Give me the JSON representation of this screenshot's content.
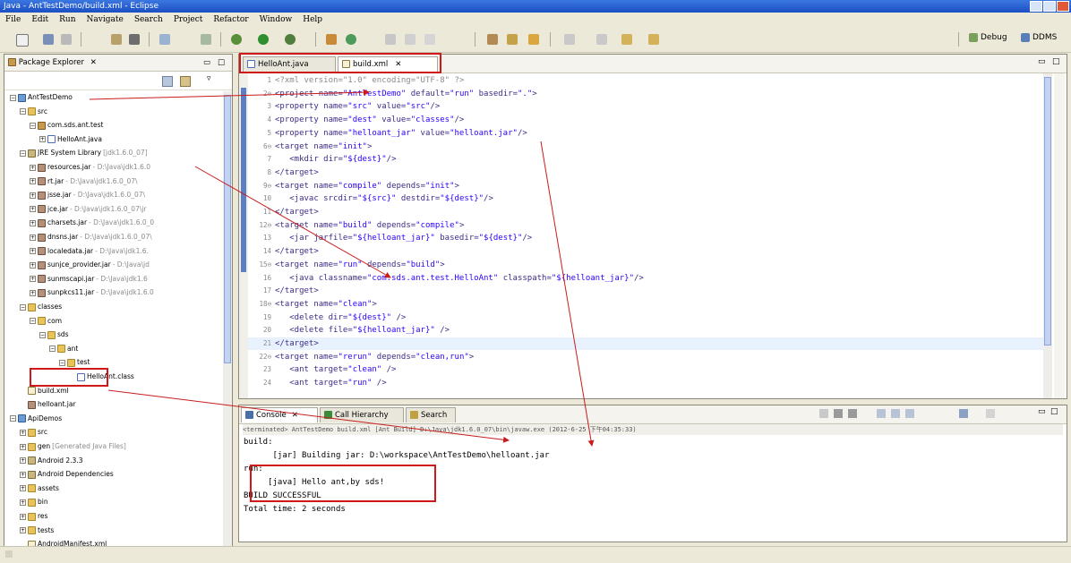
{
  "window": {
    "title": "Java - AntTestDemo/build.xml - Eclipse"
  },
  "menu": [
    "File",
    "Edit",
    "Run",
    "Navigate",
    "Search",
    "Project",
    "Refactor",
    "Window",
    "Help"
  ],
  "perspectives": {
    "debug": "Debug",
    "ddms": "DDMS"
  },
  "package_explorer": {
    "title": "Package Explorer",
    "rows": [
      {
        "label": "AntTestDemo",
        "note": "",
        "depth": 0,
        "icon": "proj",
        "tw": "-"
      },
      {
        "label": "src",
        "note": "",
        "depth": 1,
        "icon": "folder",
        "tw": "-"
      },
      {
        "label": "com.sds.ant.test",
        "note": "",
        "depth": 2,
        "icon": "pkg",
        "tw": "-"
      },
      {
        "label": "HelloAnt.java",
        "note": "",
        "depth": 3,
        "icon": "javafile",
        "tw": "+"
      },
      {
        "label": "JRE System Library",
        "note": "[jdk1.6.0_07]",
        "depth": 1,
        "icon": "lib",
        "tw": "-"
      },
      {
        "label": "resources.jar",
        "note": "- D:\\Java\\jdk1.6.0",
        "depth": 2,
        "icon": "jar",
        "tw": "+"
      },
      {
        "label": "rt.jar",
        "note": "- D:\\Java\\jdk1.6.0_07\\",
        "depth": 2,
        "icon": "jar",
        "tw": "+"
      },
      {
        "label": "jsse.jar",
        "note": "- D:\\Java\\jdk1.6.0_07\\",
        "depth": 2,
        "icon": "jar",
        "tw": "+"
      },
      {
        "label": "jce.jar",
        "note": "- D:\\Java\\jdk1.6.0_07\\jr",
        "depth": 2,
        "icon": "jar",
        "tw": "+"
      },
      {
        "label": "charsets.jar",
        "note": "- D:\\Java\\jdk1.6.0_0",
        "depth": 2,
        "icon": "jar",
        "tw": "+"
      },
      {
        "label": "dnsns.jar",
        "note": "- D:\\Java\\jdk1.6.0_07\\",
        "depth": 2,
        "icon": "jar",
        "tw": "+"
      },
      {
        "label": "localedata.jar",
        "note": "- D:\\Java\\jdk1.6.",
        "depth": 2,
        "icon": "jar",
        "tw": "+"
      },
      {
        "label": "sunjce_provider.jar",
        "note": "- D:\\Java\\jd",
        "depth": 2,
        "icon": "jar",
        "tw": "+"
      },
      {
        "label": "sunmscapi.jar",
        "note": "- D:\\Java\\jdk1.6",
        "depth": 2,
        "icon": "jar",
        "tw": "+"
      },
      {
        "label": "sunpkcs11.jar",
        "note": "- D:\\Java\\jdk1.6.0",
        "depth": 2,
        "icon": "jar",
        "tw": "+"
      },
      {
        "label": "classes",
        "note": "",
        "depth": 1,
        "icon": "folder",
        "tw": "-"
      },
      {
        "label": "com",
        "note": "",
        "depth": 2,
        "icon": "folder",
        "tw": "-"
      },
      {
        "label": "sds",
        "note": "",
        "depth": 3,
        "icon": "folder",
        "tw": "-"
      },
      {
        "label": "ant",
        "note": "",
        "depth": 4,
        "icon": "folder",
        "tw": "-"
      },
      {
        "label": "test",
        "note": "",
        "depth": 5,
        "icon": "folder",
        "tw": "-"
      },
      {
        "label": "HelloAnt.class",
        "note": "",
        "depth": 6,
        "icon": "javafile",
        "tw": ""
      },
      {
        "label": "build.xml",
        "note": "",
        "depth": 1,
        "icon": "xmlfile",
        "tw": ""
      },
      {
        "label": "helloant.jar",
        "note": "",
        "depth": 1,
        "icon": "jar",
        "tw": ""
      },
      {
        "label": "ApiDemos",
        "note": "",
        "depth": 0,
        "icon": "proj",
        "tw": "-"
      },
      {
        "label": "src",
        "note": "",
        "depth": 1,
        "icon": "folder",
        "tw": "+"
      },
      {
        "label": "gen",
        "note": "[Generated Java Files]",
        "depth": 1,
        "icon": "folder",
        "tw": "+"
      },
      {
        "label": "Android 2.3.3",
        "note": "",
        "depth": 1,
        "icon": "lib",
        "tw": "+"
      },
      {
        "label": "Android Dependencies",
        "note": "",
        "depth": 1,
        "icon": "lib",
        "tw": "+"
      },
      {
        "label": "assets",
        "note": "",
        "depth": 1,
        "icon": "folder",
        "tw": "+"
      },
      {
        "label": "bin",
        "note": "",
        "depth": 1,
        "icon": "folder",
        "tw": "+"
      },
      {
        "label": "res",
        "note": "",
        "depth": 1,
        "icon": "folder",
        "tw": "+"
      },
      {
        "label": "tests",
        "note": "",
        "depth": 1,
        "icon": "folder",
        "tw": "+"
      },
      {
        "label": "AndroidManifest.xml",
        "note": "",
        "depth": 1,
        "icon": "xmlfile",
        "tw": ""
      }
    ]
  },
  "editor": {
    "tabs": [
      {
        "label": "HelloAnt.java",
        "icon": "javafile",
        "active": false
      },
      {
        "label": "build.xml",
        "icon": "xmlfile",
        "active": true
      }
    ],
    "lines": [
      {
        "n": "1",
        "text": "<?xml version=\"1.0\" encoding=\"UTF-8\" ?>",
        "kind": "pi"
      },
      {
        "n": "2⊖",
        "text": "<project name=\"AntTestDemo\" default=\"run\" basedir=\".\">",
        "kind": "tag"
      },
      {
        "n": "3",
        "text": "<property name=\"src\" value=\"src\"/>",
        "kind": "tag"
      },
      {
        "n": "4",
        "text": "<property name=\"dest\" value=\"classes\"/>",
        "kind": "tag"
      },
      {
        "n": "5",
        "text": "<property name=\"helloant_jar\" value=\"helloant.jar\"/>",
        "kind": "tag"
      },
      {
        "n": "6⊖",
        "text": "<target name=\"init\">",
        "kind": "tag"
      },
      {
        "n": "7",
        "text": "   <mkdir dir=\"${dest}\"/>",
        "kind": "tag"
      },
      {
        "n": "8",
        "text": "</target>",
        "kind": "tag"
      },
      {
        "n": "9⊖",
        "text": "<target name=\"compile\" depends=\"init\">",
        "kind": "tag"
      },
      {
        "n": "10",
        "text": "   <javac srcdir=\"${src}\" destdir=\"${dest}\"/>",
        "kind": "tag"
      },
      {
        "n": "11",
        "text": "</target>",
        "kind": "tag"
      },
      {
        "n": "12⊖",
        "text": "<target name=\"build\" depends=\"compile\">",
        "kind": "tag"
      },
      {
        "n": "13",
        "text": "   <jar jarfile=\"${helloant_jar}\" basedir=\"${dest}\"/>",
        "kind": "tag"
      },
      {
        "n": "14",
        "text": "</target>",
        "kind": "tag"
      },
      {
        "n": "15⊖",
        "text": "<target name=\"run\" depends=\"build\">",
        "kind": "tag"
      },
      {
        "n": "16",
        "text": "   <java classname=\"com.sds.ant.test.HelloAnt\" classpath=\"${helloant_jar}\"/>",
        "kind": "tag"
      },
      {
        "n": "17",
        "text": "</target>",
        "kind": "tag"
      },
      {
        "n": "18⊖",
        "text": "<target name=\"clean\">",
        "kind": "tag"
      },
      {
        "n": "19",
        "text": "   <delete dir=\"${dest}\" />",
        "kind": "tag"
      },
      {
        "n": "20",
        "text": "   <delete file=\"${helloant_jar}\" />",
        "kind": "tag"
      },
      {
        "n": "21",
        "text": "</target>",
        "kind": "tag"
      },
      {
        "n": "22⊖",
        "text": "<target name=\"rerun\" depends=\"clean,run\">",
        "kind": "tag"
      },
      {
        "n": "23",
        "text": "   <ant target=\"clean\" />",
        "kind": "tag"
      },
      {
        "n": "24",
        "text": "   <ant target=\"run\" />",
        "kind": "tag"
      }
    ]
  },
  "console": {
    "tabs": [
      {
        "label": "Console",
        "active": true
      },
      {
        "label": "Call Hierarchy",
        "active": false
      },
      {
        "label": "Search",
        "active": false
      }
    ],
    "header": "<terminated> AntTestDemo build.xml [Ant Build] D:\\Java\\jdk1.6.0_07\\bin\\javaw.exe (2012-6-25 下午04:35:33)",
    "lines": [
      "build:",
      "      [jar] Building jar: D:\\workspace\\AntTestDemo\\helloant.jar",
      "run:",
      "     [java] Hello ant,by sds!",
      "BUILD SUCCESSFUL",
      "Total time: 2 seconds"
    ]
  },
  "colors": {
    "annotation_red": "#d01818",
    "titlebar_blue": "#1b4fc4",
    "current_line": "#e8f2fe"
  }
}
